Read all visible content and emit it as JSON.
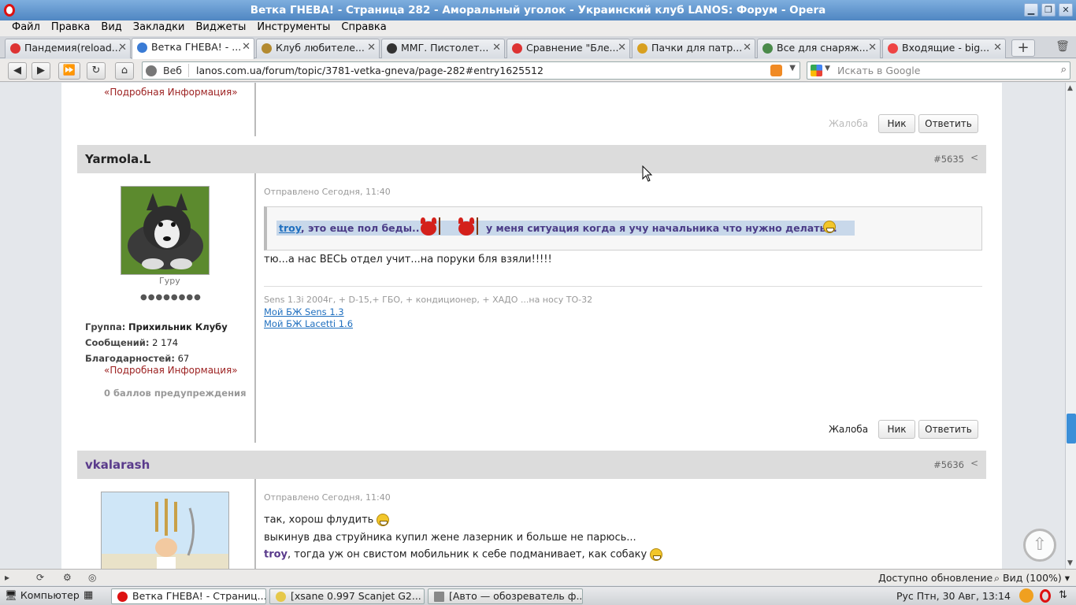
{
  "window": {
    "title": "Ветка ГНЕВА! - Страница 282 - Аморальный уголок - Украинский клуб LANOS: Форум - Opera"
  },
  "menu": [
    "Файл",
    "Правка",
    "Вид",
    "Закладки",
    "Виджеты",
    "Инструменты",
    "Справка"
  ],
  "tabs": [
    {
      "label": "Пандемия(reload...",
      "icon_color": "#d33"
    },
    {
      "label": "Ветка ГНЕВА! - ...",
      "icon_color": "#3a7bd5",
      "active": true
    },
    {
      "label": "Клуб любителе...",
      "icon_color": "#b38a30"
    },
    {
      "label": "ММГ. Пистолет...",
      "icon_color": "#333"
    },
    {
      "label": "Сравнение \"Бле...",
      "icon_color": "#d33"
    },
    {
      "label": "Пачки для патр...",
      "icon_color": "#d8a020"
    },
    {
      "label": "Все для снаряж...",
      "icon_color": "#4a8a4a"
    },
    {
      "label": "Входящие - big...",
      "icon_color": "#e44"
    }
  ],
  "nav": {
    "web_label": "Веб",
    "url": "lanos.com.ua/forum/topic/3781-vetka-gneva/page-282#entry1625512",
    "search_placeholder": "Искать в Google"
  },
  "prev_post": {
    "more_info": "«Подробная Информация»",
    "complaint": "Жалоба",
    "nick_btn": "Ник",
    "reply_btn": "Ответить"
  },
  "post1": {
    "author": "Yarmola.L",
    "number": "#5635",
    "rank": "Гуру",
    "rank_dots": "●●●●●●●●",
    "group_label": "Группа:",
    "group_value": "Прихильник Клубу",
    "messages_label": "Сообщений:",
    "messages_value": "2 174",
    "thanks_label": "Благодарностей:",
    "thanks_value": "67",
    "more_info": "«Подробная Информация»",
    "warnings": "0 баллов предупреждения",
    "posted": "Отправлено Сегодня, 11:40",
    "quote_user": "troy",
    "quote_text1": ", это еще пол беды..",
    "quote_text2": "у меня ситуация когда я учу начальника что нужно делать...",
    "text": "тю...а нас  ВЕСЬ отдел учит...на поруки бля взяли!!!!!",
    "sig_line": "Sens 1.3i 2004г, + D-15,+ ГБО, + кондиционер, + ХАДО ...на носу ТО-32",
    "sig_link1": "Мой БЖ Sens 1.3",
    "sig_link2": "Мой БЖ Lacetti 1.6",
    "complaint": "Жалоба",
    "nick_btn": "Ник",
    "reply_btn": "Ответить"
  },
  "post2": {
    "author": "vkalarash",
    "number": "#5636",
    "posted": "Отправлено Сегодня, 11:40",
    "line1": "так, хорош флудить",
    "line2": "выкинув два струйника купил жене лазерник и больше не парюсь...",
    "line3_user": "troy",
    "line3": ", тогда уж он свистом мобильник к себе подманивает, как собаку"
  },
  "status": {
    "update": "Доступно обновление",
    "zoom": "Вид (100%)"
  },
  "taskbar": {
    "computer": "Компьютер",
    "tasks": [
      {
        "label": "Ветка ГНЕВА! - Страниц...",
        "active": true,
        "icon_color": "#d11"
      },
      {
        "label": "[xsane 0.997 Scanjet G2...",
        "icon_color": "#e6c84a"
      },
      {
        "label": "[Авто — обозреватель ф...",
        "icon_color": "#888"
      }
    ],
    "tray": "Рус  Птн, 30 Авг, 13:14"
  }
}
